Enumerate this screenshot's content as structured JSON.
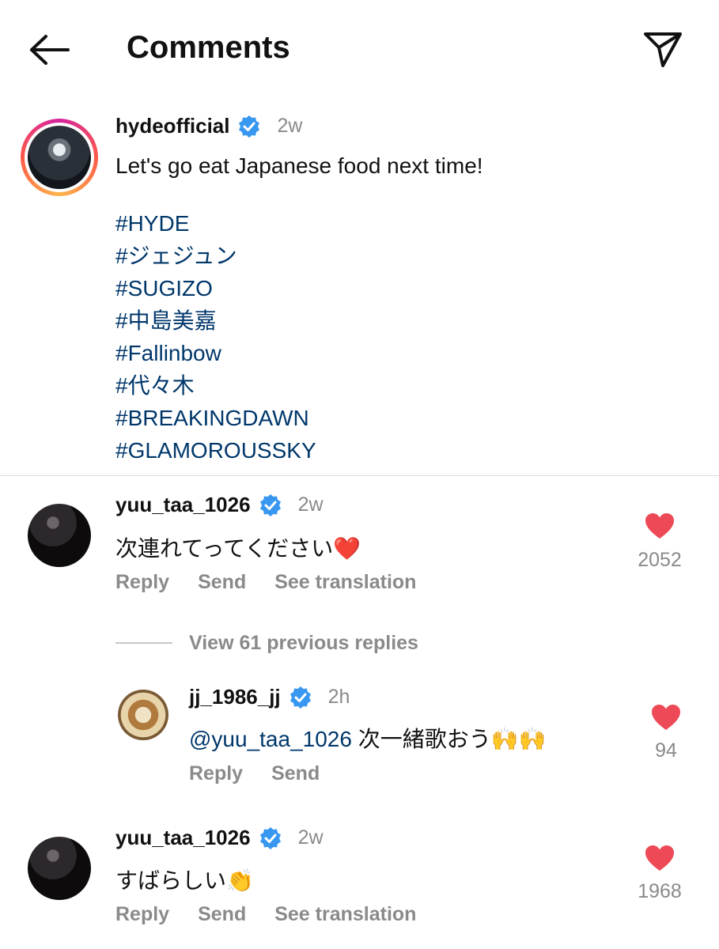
{
  "header": {
    "title": "Comments",
    "back_icon": "arrow-left-icon",
    "send_icon": "paper-plane-icon"
  },
  "caption": {
    "username": "hydeofficial",
    "verified": true,
    "time": "2w",
    "text": "Let's go eat Japanese food next time!",
    "hashtags": [
      "#HYDE",
      "#ジェジュン",
      "#SUGIZO",
      "#中島美嘉",
      "#Fallinbow",
      "#代々木",
      "#BREAKINGDAWN",
      "#GLAMOROUSSKY"
    ]
  },
  "comments": [
    {
      "username": "yuu_taa_1026",
      "time": "2w",
      "text": "次連れてってください❤️",
      "likes": "2052",
      "actions": {
        "reply": "Reply",
        "send": "Send",
        "translate": "See translation"
      }
    },
    {
      "username": "yuu_taa_1026",
      "time": "2w",
      "text": "すばらしい👏",
      "likes": "1968",
      "actions": {
        "reply": "Reply",
        "send": "Send",
        "translate": "See translation"
      }
    }
  ],
  "replies_toggle": "View 61 previous replies",
  "reply": {
    "username": "jj_1986_jj",
    "time": "2h",
    "mention": "@yuu_taa_1026",
    "text": " 次一緒歌おう🙌🙌",
    "likes": "94",
    "actions": {
      "reply": "Reply",
      "send": "Send"
    }
  },
  "colors": {
    "heart": "#ed4956",
    "verified": "#3897f0",
    "hashtag": "#00376b",
    "muted": "#8a8a8a"
  }
}
